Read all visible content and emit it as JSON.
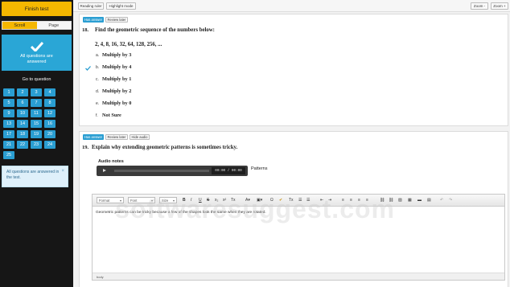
{
  "sidebar": {
    "finish_label": "Finish test",
    "view_modes": [
      "Scroll",
      "Page"
    ],
    "answered_label": "All questions are answered",
    "goto_label": "Go to question",
    "question_numbers": [
      "1",
      "2",
      "3",
      "4",
      "5",
      "6",
      "7",
      "8",
      "9",
      "10",
      "11",
      "12",
      "13",
      "14",
      "15",
      "16",
      "17",
      "18",
      "19",
      "20",
      "21",
      "22",
      "23",
      "24",
      "25"
    ],
    "notice": "All questions are answered in the test.",
    "accent": "#f5b700",
    "tile_color": "#2a9ed2"
  },
  "toolbar": {
    "reading_ruler": "Reading ruler",
    "highlight_mode": "Highlight mode",
    "zoom_out": "Zoom -",
    "zoom_in": "Zoom +"
  },
  "q18": {
    "badge": "Has answer",
    "review": "Review later",
    "number": "18.",
    "text": "Find the geometric sequence of the numbers below:",
    "sequence": "2, 4, 8, 16, 32, 64, 128, 256, ...",
    "options": [
      {
        "letter": "a.",
        "text": "Multiply by 3"
      },
      {
        "letter": "b.",
        "text": "Multiply by 4"
      },
      {
        "letter": "c.",
        "text": "Multiply by 1"
      },
      {
        "letter": "d.",
        "text": "Multiply by 2"
      },
      {
        "letter": "e.",
        "text": "Multiply by 0"
      },
      {
        "letter": "f.",
        "text": "Not Sure"
      }
    ],
    "selected": "b."
  },
  "q19": {
    "badge": "Has answer",
    "review": "Review later",
    "hide_audio": "Hide audio",
    "number": "19.",
    "text": "Explain why extending geometric patterns is sometimes tricky.",
    "audio_label": "Audio notes",
    "audio_time": "00:00 / 00:00",
    "audio_caption": "Patterns",
    "editor": {
      "format": "Format",
      "font": "Font",
      "size": "Size",
      "content": "Geometric patterns can be tricky because a few of the shapes look the same when they are rotated.",
      "status": "body"
    }
  },
  "watermark": "softwaresuggest.com"
}
